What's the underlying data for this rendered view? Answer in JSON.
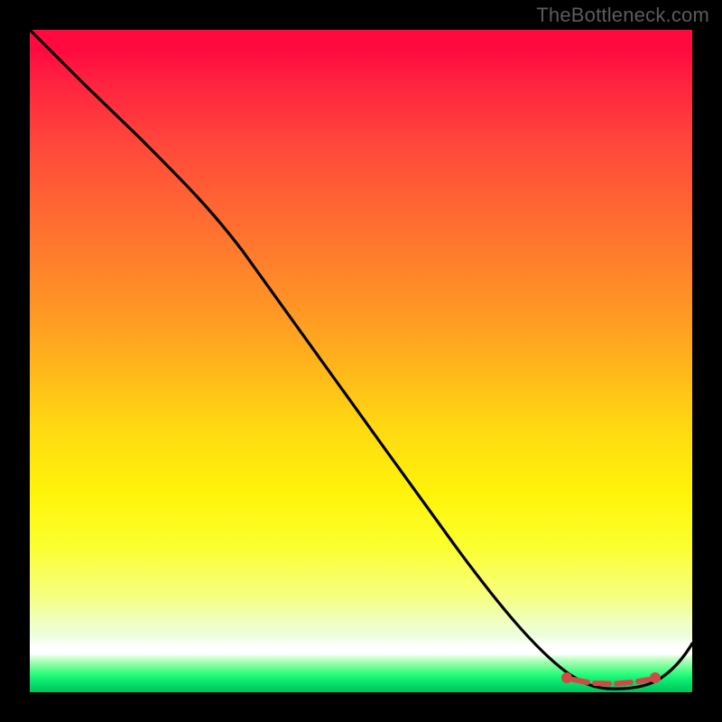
{
  "watermark": "TheBottleneck.com",
  "colors": {
    "curve_stroke": "#000000",
    "decor_stroke": "#d24a45",
    "background_frame": "#000000"
  },
  "chart_data": {
    "type": "line",
    "title": "",
    "xlabel": "",
    "ylabel": "",
    "xlim": [
      0,
      100
    ],
    "ylim": [
      0,
      100
    ],
    "grid": false,
    "series": [
      {
        "name": "curve",
        "x": [
          0,
          5,
          12,
          20,
          28,
          35,
          42,
          50,
          58,
          66,
          73,
          79,
          84,
          88,
          92,
          96,
          100
        ],
        "y": [
          100,
          95,
          89,
          82,
          74,
          65,
          55,
          44,
          33,
          22,
          12,
          5,
          1,
          0,
          0,
          3,
          8
        ]
      }
    ],
    "annotations": [
      {
        "name": "minimum-marker",
        "approx_x_range": [
          81,
          93
        ],
        "approx_y": 1,
        "style": "dashed-red-with-end-dots"
      }
    ]
  }
}
